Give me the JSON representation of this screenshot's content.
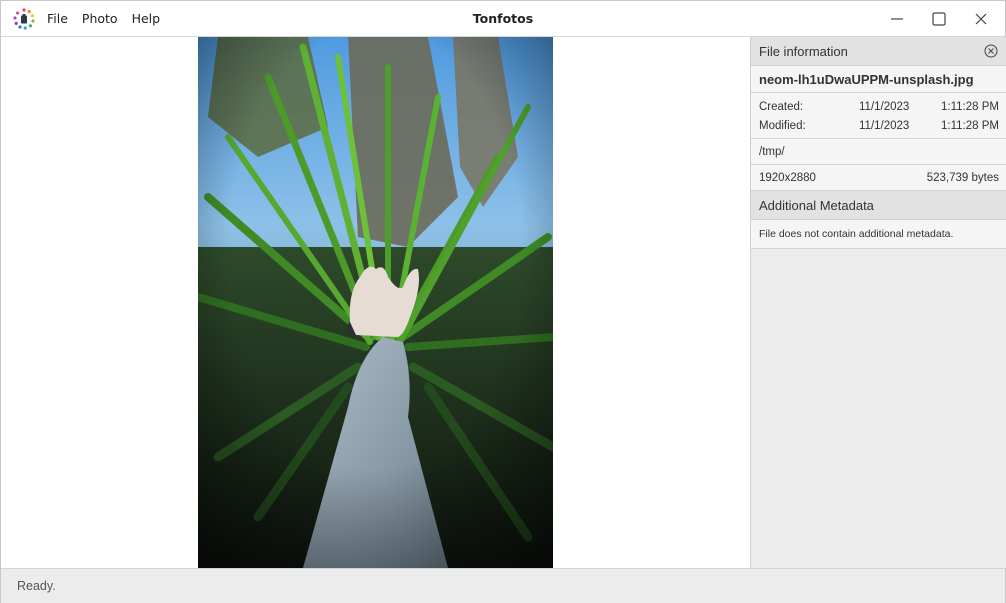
{
  "window": {
    "title": "Tonfotos"
  },
  "menu": {
    "items": [
      "File",
      "Photo",
      "Help"
    ]
  },
  "panel": {
    "header": "File information",
    "filename": "neom-lh1uDwaUPPM-unsplash.jpg",
    "created": {
      "label": "Created:",
      "date": "11/1/2023",
      "time": "1:11:28 PM"
    },
    "modified": {
      "label": "Modified:",
      "date": "11/1/2023",
      "time": "1:11:28 PM"
    },
    "path": "/tmp/",
    "dimensions": "1920x2880",
    "size": "523,739 bytes",
    "additional_header": "Additional Metadata",
    "additional_note": "File does not contain additional metadata."
  },
  "status": {
    "text": "Ready."
  },
  "icons": {
    "app": "tonfotos-app-icon",
    "minimize": "minimize-icon",
    "maximize": "maximize-icon",
    "close": "close-icon",
    "panel_close": "close-circle-icon"
  }
}
